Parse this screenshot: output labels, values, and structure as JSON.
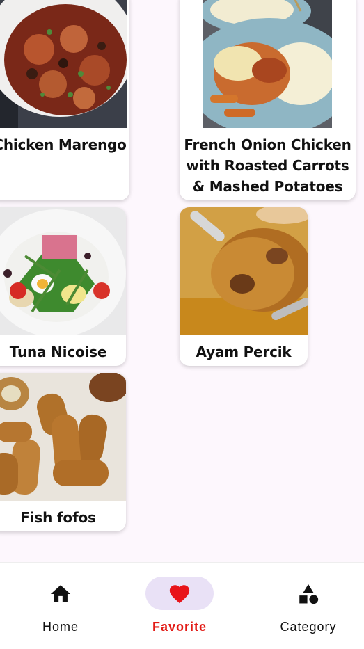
{
  "recipes": [
    {
      "title": "Chicken Marengo",
      "image": "chicken-marengo-photo"
    },
    {
      "title": "French Onion Chicken with Roasted Carrots & Mashed Potatoes",
      "image": "french-onion-chicken-photo"
    },
    {
      "title": "Tuna Nicoise",
      "image": "tuna-nicoise-photo"
    },
    {
      "title": "Ayam Percik",
      "image": "ayam-percik-photo"
    },
    {
      "title": "Fish fofos",
      "image": "fish-fofos-photo"
    }
  ],
  "bottom_nav": {
    "items": [
      {
        "label": "Home",
        "icon": "home-icon",
        "active": false
      },
      {
        "label": "Favorite",
        "icon": "heart-icon",
        "active": true
      },
      {
        "label": "Category",
        "icon": "category-icon",
        "active": false
      }
    ]
  },
  "colors": {
    "background": "#fdf7fd",
    "card": "#ffffff",
    "active_label": "#e21b16",
    "active_pill": "#e9e1f6",
    "heart": "#e8141a"
  }
}
